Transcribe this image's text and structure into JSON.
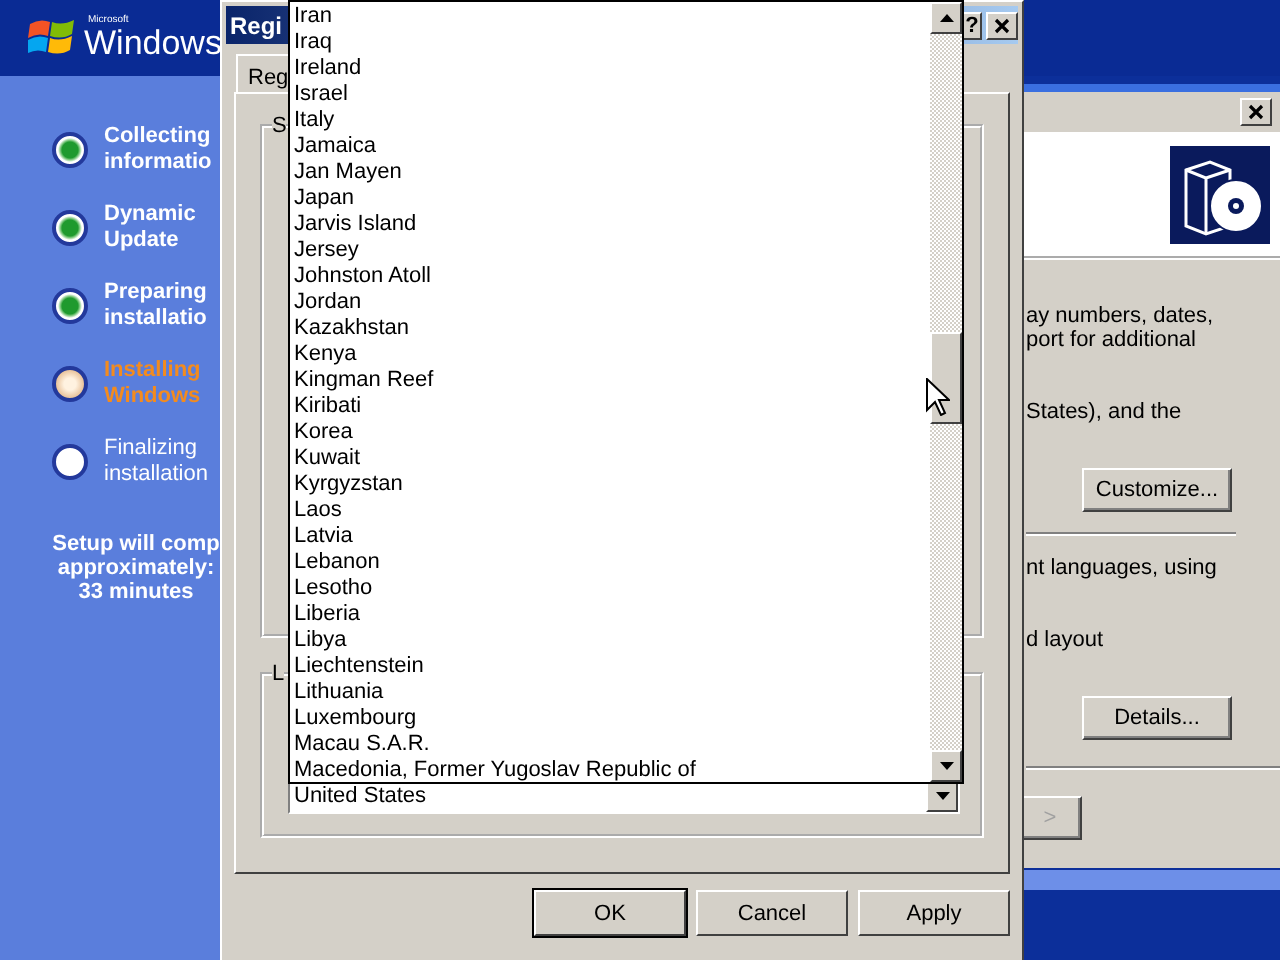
{
  "setup": {
    "logo": {
      "brand": "Microsoft",
      "product": "Windows"
    },
    "steps": [
      {
        "label": [
          "Collecting",
          "informatio"
        ],
        "kind": "done"
      },
      {
        "label": [
          "Dynamic",
          "Update"
        ],
        "kind": "done"
      },
      {
        "label": [
          "Preparing",
          "installatio"
        ],
        "kind": "done"
      },
      {
        "label": [
          "Installing",
          "Windows"
        ],
        "kind": "current"
      },
      {
        "label": [
          "Finalizing",
          "installation"
        ],
        "kind": "pending"
      }
    ],
    "estimate": [
      "Setup will comp",
      "approximately:",
      "33 minutes"
    ]
  },
  "background_window": {
    "intro": [
      "ay numbers, dates,",
      "port for additional"
    ],
    "format_note": "States), and the",
    "customize_button": "Customize...",
    "language_note": "nt languages, using",
    "keyboard_note": "d layout",
    "details_button": "Details...",
    "next_button": {
      "label": ">",
      "disabled": true
    }
  },
  "dialog": {
    "title": "Regi",
    "help_button": "?",
    "tabs": [
      {
        "label": "Reg",
        "selected": true
      }
    ],
    "groups": [
      "S",
      "L"
    ],
    "location": {
      "value": "United States"
    },
    "dropdown": {
      "items": [
        "Iran",
        "Iraq",
        "Ireland",
        "Israel",
        "Italy",
        "Jamaica",
        "Jan Mayen",
        "Japan",
        "Jarvis Island",
        "Jersey",
        "Johnston Atoll",
        "Jordan",
        "Kazakhstan",
        "Kenya",
        "Kingman Reef",
        "Kiribati",
        "Korea",
        "Kuwait",
        "Kyrgyzstan",
        "Laos",
        "Latvia",
        "Lebanon",
        "Lesotho",
        "Liberia",
        "Libya",
        "Liechtenstein",
        "Lithuania",
        "Luxembourg",
        "Macau S.A.R.",
        "Macedonia, Former Yugoslav Republic of"
      ]
    },
    "buttons": [
      {
        "label": "OK",
        "default": true
      },
      {
        "label": "Cancel",
        "default": false
      },
      {
        "label": "Apply",
        "default": false
      }
    ]
  }
}
